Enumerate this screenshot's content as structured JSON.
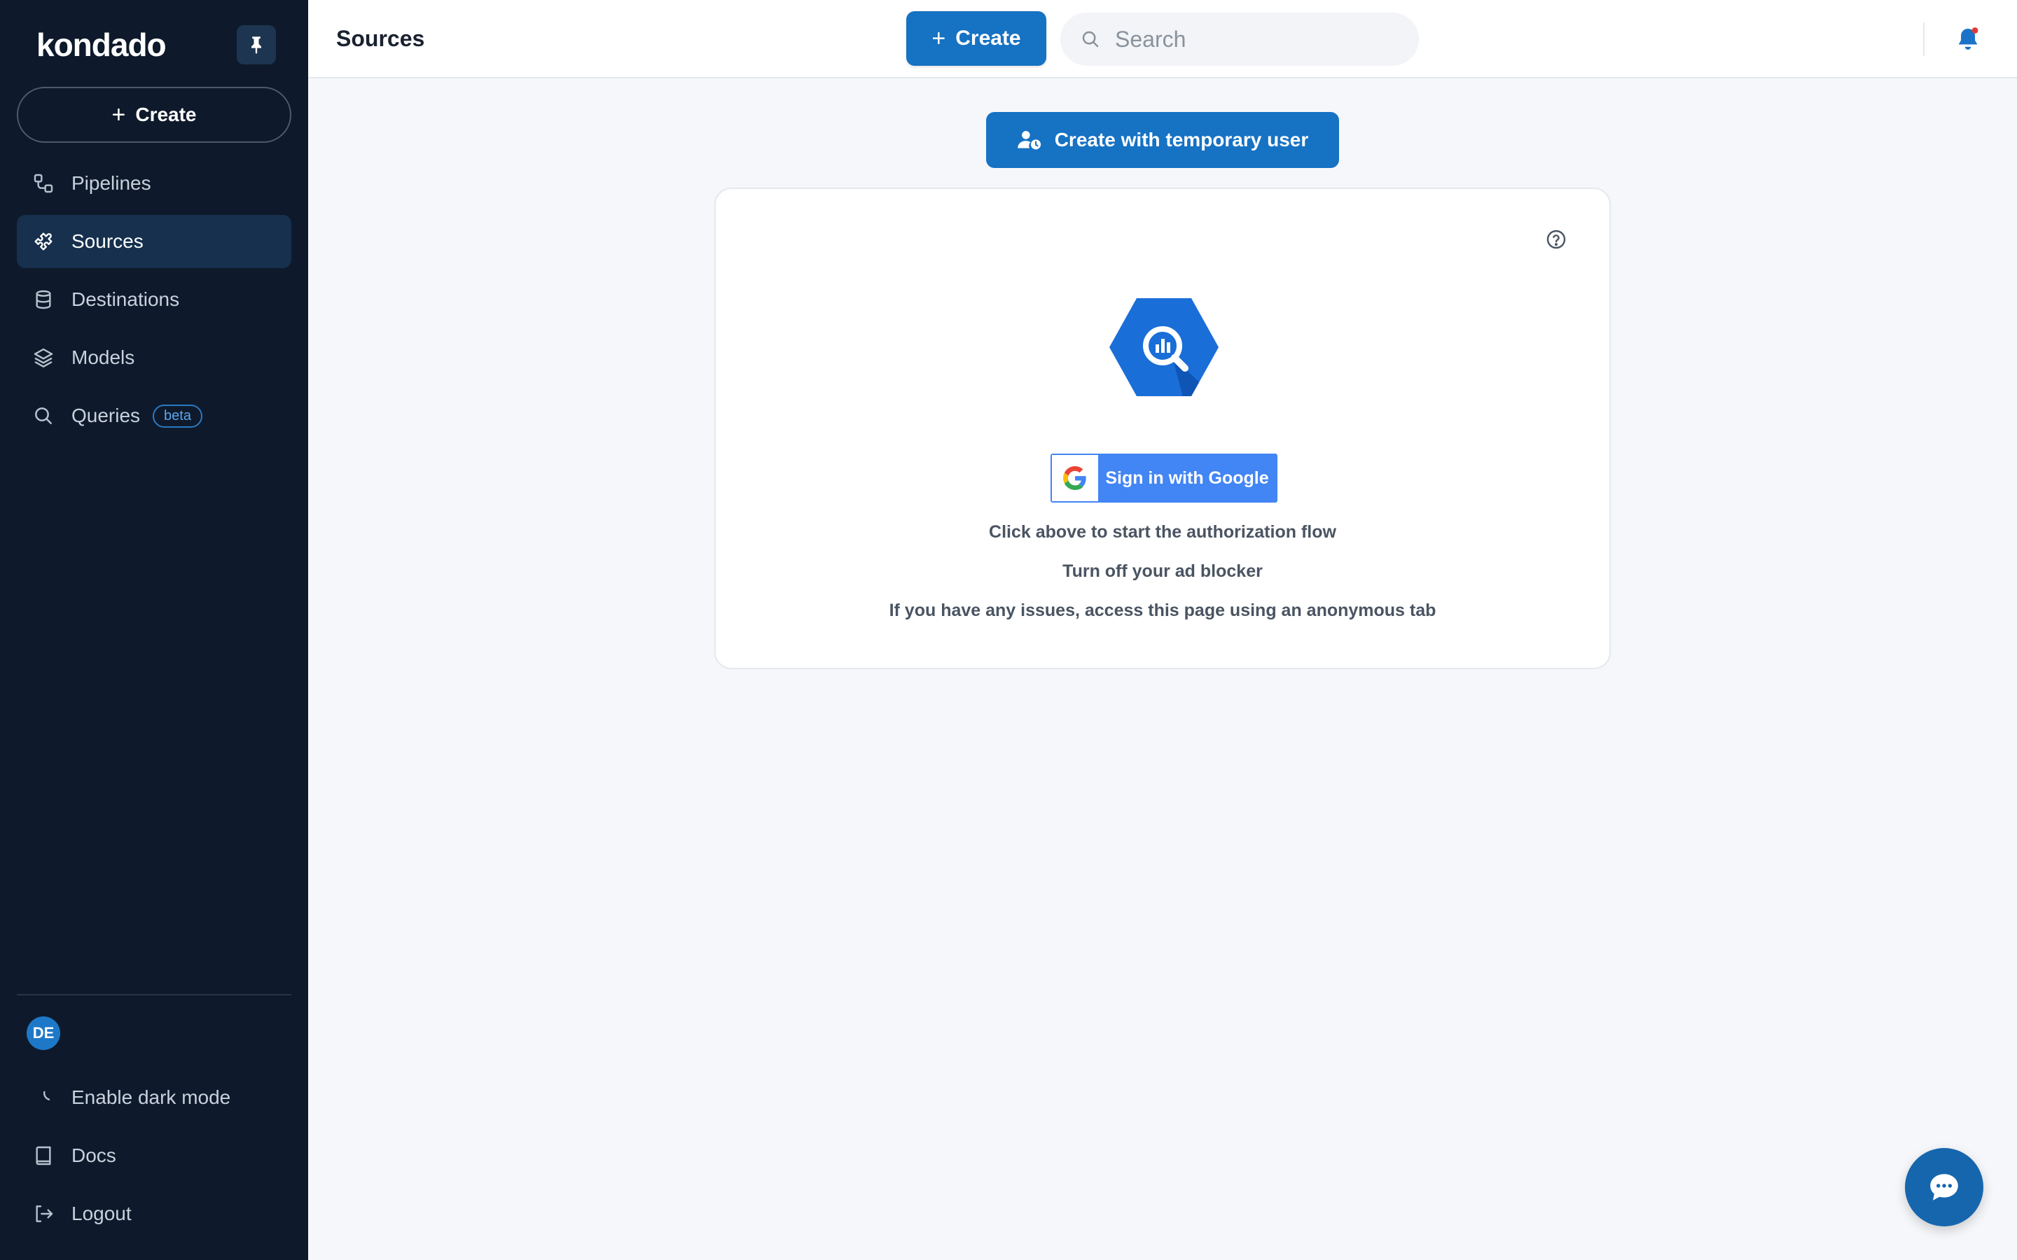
{
  "sidebar": {
    "logo": "kondado",
    "create_label": "Create",
    "items": [
      {
        "label": "Pipelines",
        "icon": "pipelines-icon"
      },
      {
        "label": "Sources",
        "icon": "puzzle-icon"
      },
      {
        "label": "Destinations",
        "icon": "database-icon"
      },
      {
        "label": "Models",
        "icon": "layers-icon"
      },
      {
        "label": "Queries",
        "icon": "search-icon",
        "badge": "beta"
      }
    ],
    "active_item": "Sources",
    "user_initials": "DE",
    "bottom_items": [
      {
        "label": "Enable dark mode",
        "icon": "moon-icon"
      },
      {
        "label": "Docs",
        "icon": "book-icon"
      },
      {
        "label": "Logout",
        "icon": "logout-icon"
      }
    ]
  },
  "topbar": {
    "title": "Sources",
    "create_label": "Create",
    "search_placeholder": "Search"
  },
  "main": {
    "temp_user_button": "Create with temporary user",
    "google_button": "Sign in with Google",
    "hints": [
      "Click above to start the authorization flow",
      "Turn off your ad blocker",
      "If you have any issues, access this page using an anonymous tab"
    ]
  },
  "colors": {
    "sidebar_bg": "#0e1a2b",
    "sidebar_active": "#16304d",
    "primary": "#1672c3",
    "google_blue": "#4285f4",
    "bigquery_blue": "#1a6ed8",
    "notification_dot": "#e53935"
  }
}
